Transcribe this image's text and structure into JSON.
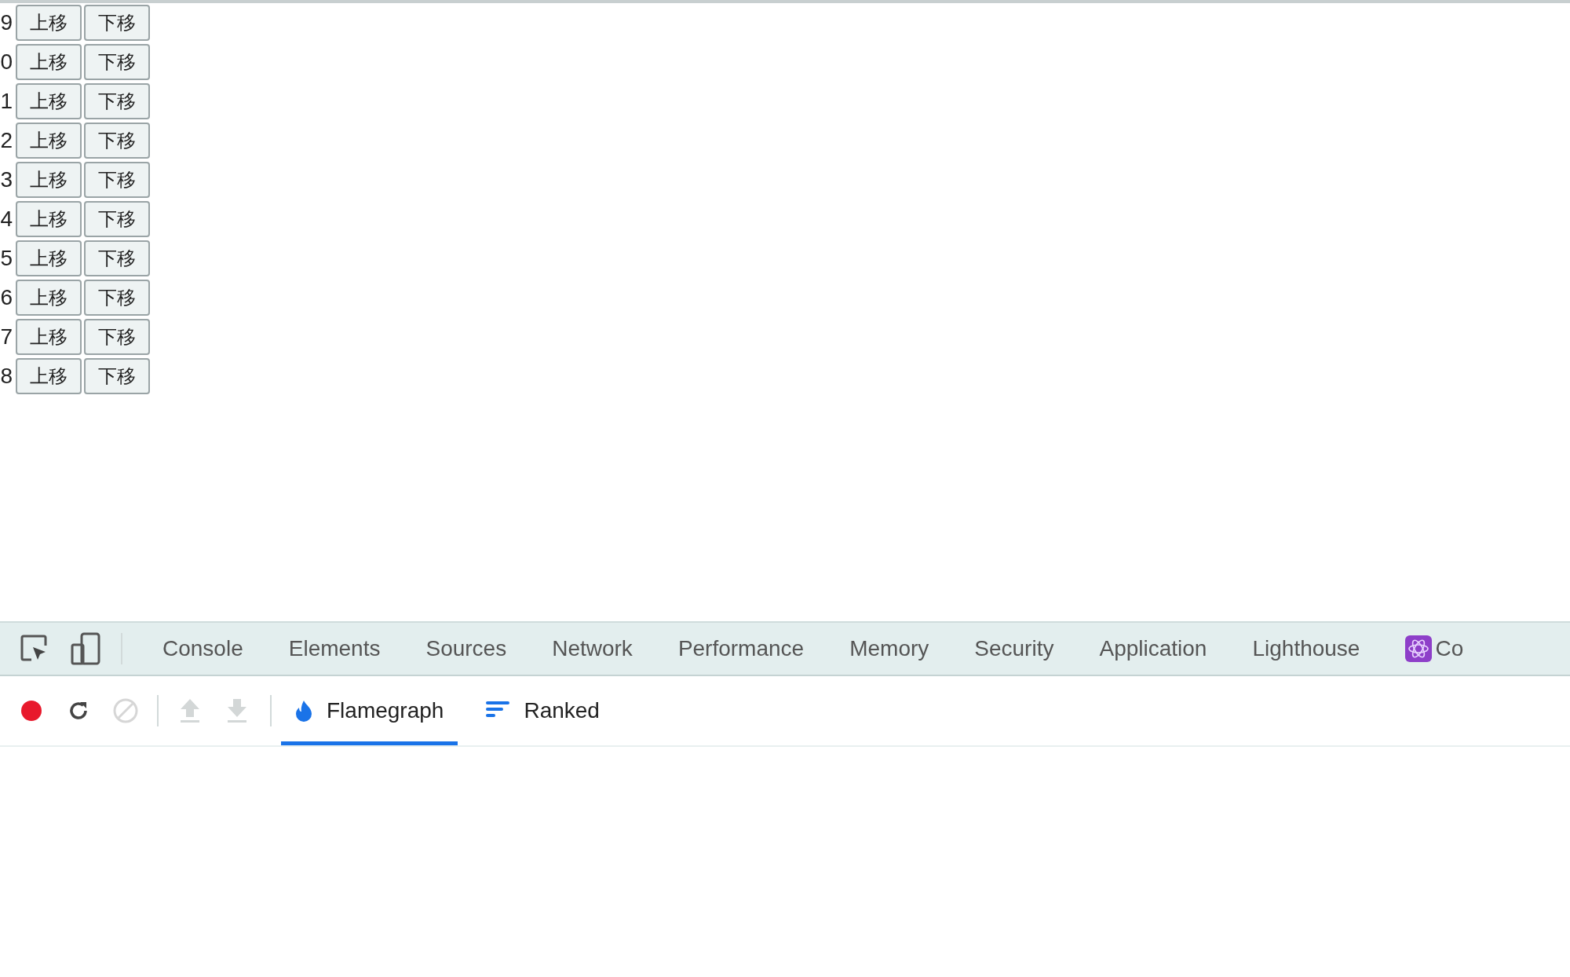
{
  "rows": [
    {
      "index": "9",
      "up": "上移",
      "down": "下移"
    },
    {
      "index": "0",
      "up": "上移",
      "down": "下移"
    },
    {
      "index": "1",
      "up": "上移",
      "down": "下移"
    },
    {
      "index": "2",
      "up": "上移",
      "down": "下移"
    },
    {
      "index": "3",
      "up": "上移",
      "down": "下移"
    },
    {
      "index": "4",
      "up": "上移",
      "down": "下移"
    },
    {
      "index": "5",
      "up": "上移",
      "down": "下移"
    },
    {
      "index": "6",
      "up": "上移",
      "down": "下移"
    },
    {
      "index": "7",
      "up": "上移",
      "down": "下移"
    },
    {
      "index": "8",
      "up": "上移",
      "down": "下移"
    }
  ],
  "devtools": {
    "tabs": [
      "Console",
      "Elements",
      "Sources",
      "Network",
      "Performance",
      "Memory",
      "Security",
      "Application",
      "Lighthouse",
      "Co"
    ],
    "profiler_tabs": [
      {
        "label": "Flamegraph",
        "kind": "flame",
        "selected": true
      },
      {
        "label": "Ranked",
        "kind": "ranked",
        "selected": false
      }
    ]
  }
}
